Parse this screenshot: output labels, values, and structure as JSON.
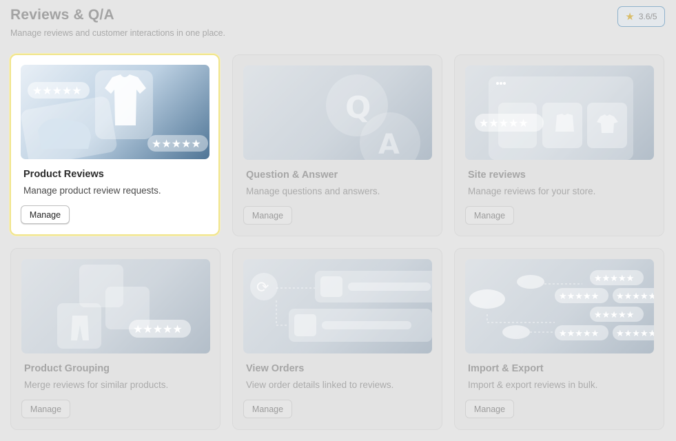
{
  "header": {
    "title": "Reviews & Q/A",
    "subtitle": "Manage reviews and customer interactions in one place."
  },
  "rating": {
    "icon": "star-icon",
    "value": "3.6/5",
    "color": "#d9bd6a"
  },
  "cards": [
    {
      "title": "Product Reviews",
      "description": "Manage product review requests.",
      "button": "Manage",
      "active": true
    },
    {
      "title": "Question & Answer",
      "description": "Manage questions and answers.",
      "button": "Manage",
      "active": false
    },
    {
      "title": "Site reviews",
      "description": "Manage reviews for your store.",
      "button": "Manage",
      "active": false
    },
    {
      "title": "Product Grouping",
      "description": "Merge reviews for similar products.",
      "button": "Manage",
      "active": false
    },
    {
      "title": "View Orders",
      "description": "View order details linked to reviews.",
      "button": "Manage",
      "active": false
    },
    {
      "title": "Import & Export",
      "description": "Import & export reviews in bulk.",
      "button": "Manage",
      "active": false
    }
  ],
  "colors": {
    "background": "#e6e6e6",
    "active_border": "#f1e58c",
    "badge_border": "#8fb2cc"
  }
}
